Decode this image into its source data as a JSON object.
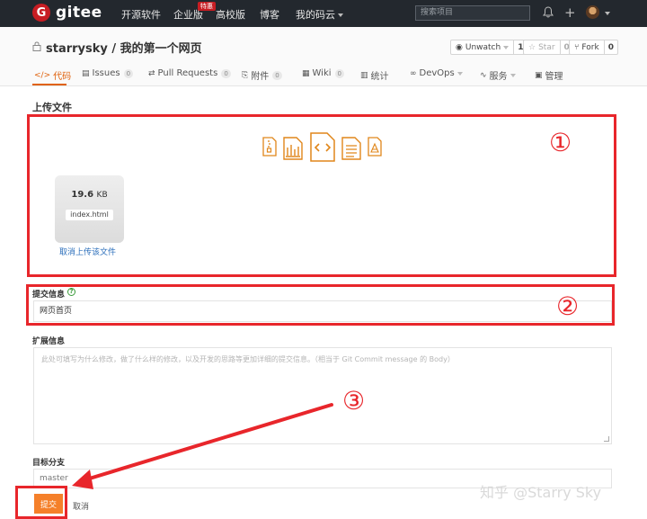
{
  "brand": {
    "mark": "G",
    "name": "gitee"
  },
  "nav": {
    "items": [
      "开源软件",
      "企业版",
      "高校版",
      "博客",
      "我的码云"
    ],
    "enterprise_badge": "特惠",
    "search_placeholder": "搜索项目"
  },
  "repo": {
    "title": "starrysky / 我的第一个网页",
    "watch": {
      "label": "Unwatch",
      "count": "1"
    },
    "star": {
      "label": "Star",
      "count": "0"
    },
    "fork": {
      "label": "Fork",
      "count": "0"
    }
  },
  "tabs": [
    {
      "icon": "</>",
      "label": "代码",
      "count": ""
    },
    {
      "icon": "▤",
      "label": "Issues",
      "count": "0"
    },
    {
      "icon": "⇄",
      "label": "Pull Requests",
      "count": "0"
    },
    {
      "icon": "⎘",
      "label": "附件",
      "count": "0"
    },
    {
      "icon": "▦",
      "label": "Wiki",
      "count": "0"
    },
    {
      "icon": "▥",
      "label": "统计",
      "count": ""
    },
    {
      "icon": "∞",
      "label": "DevOps",
      "count": ""
    },
    {
      "icon": "∿",
      "label": "服务",
      "count": ""
    },
    {
      "icon": "▣",
      "label": "管理",
      "count": ""
    }
  ],
  "upload": {
    "section_title": "上传文件",
    "file_size": "19.6",
    "file_size_unit": "KB",
    "file_name": "index.html",
    "cancel_label": "取消上传该文件"
  },
  "commit": {
    "label": "提交信息",
    "value": "网页首页"
  },
  "extended": {
    "label": "扩展信息",
    "placeholder": "此处可填写为什么修改，做了什么样的修改，以及开发的思路等更加详细的提交信息。（相当于 Git Commit message 的 Body）"
  },
  "branch": {
    "label": "目标分支",
    "value": "master"
  },
  "actions": {
    "submit": "提交",
    "cancel": "取消"
  },
  "annotations": {
    "one": "①",
    "two": "②",
    "three": "③"
  },
  "watermark": "知乎 @Starry Sky",
  "colors": {
    "accent": "#f5802a",
    "annotation": "#e8262b",
    "topbar": "#23282e",
    "brand": "#c71d23",
    "link": "#2c6fbb"
  }
}
